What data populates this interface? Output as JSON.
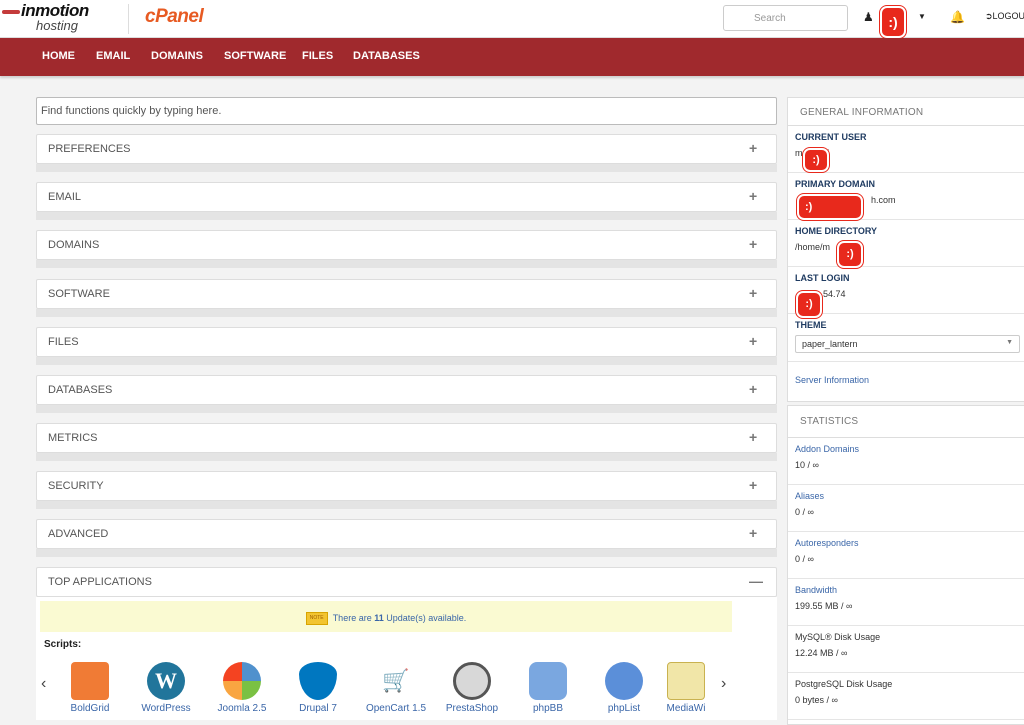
{
  "header": {
    "brand_line1": "inmotion",
    "brand_line2": "hosting",
    "product_logo": "cPanel",
    "search_placeholder": "Search",
    "user_avatar_text": ":)",
    "logout_label": "LOGOU",
    "icons": [
      "user-icon",
      "caret-down-icon",
      "bell-icon",
      "logout-icon"
    ]
  },
  "nav": {
    "items": [
      "HOME",
      "EMAIL",
      "DOMAINS",
      "SOFTWARE",
      "FILES",
      "DATABASES"
    ]
  },
  "main": {
    "find_placeholder": "Find functions quickly by typing here.",
    "groups": [
      {
        "title": "PREFERENCES",
        "toggle": "+"
      },
      {
        "title": "EMAIL",
        "toggle": "+"
      },
      {
        "title": "DOMAINS",
        "toggle": "+"
      },
      {
        "title": "SOFTWARE",
        "toggle": "+"
      },
      {
        "title": "FILES",
        "toggle": "+"
      },
      {
        "title": "DATABASES",
        "toggle": "+"
      },
      {
        "title": "METRICS",
        "toggle": "+"
      },
      {
        "title": "SECURITY",
        "toggle": "+"
      },
      {
        "title": "ADVANCED",
        "toggle": "+"
      },
      {
        "title": "TOP APPLICATIONS",
        "toggle": "—"
      }
    ],
    "update_note_icon_text": "NOTE",
    "update_text_before": "There are",
    "update_count": "11",
    "update_text_after": "Update(s) available.",
    "scripts_label": "Scripts:",
    "prev_arrow": "‹",
    "next_arrow": "›",
    "apps": [
      {
        "name": "BoldGrid",
        "color": "#f07b35"
      },
      {
        "name": "WordPress",
        "color": "#21759b"
      },
      {
        "name": "Joomla 2.5",
        "color": "#5091cd"
      },
      {
        "name": "Drupal 7",
        "color": "#0077c0"
      },
      {
        "name": "OpenCart 1.5",
        "color": "#23a8e0"
      },
      {
        "name": "PrestaShop",
        "color": "#bebebe"
      },
      {
        "name": "phpBB",
        "color": "#7aa7e0"
      },
      {
        "name": "phpList",
        "color": "#5b8fd9"
      },
      {
        "name": "MediaWi",
        "color": "#d8c25a"
      }
    ]
  },
  "sidebar": {
    "general_title": "GENERAL INFORMATION",
    "current_user_label": "CURRENT USER",
    "current_user_value_start": "m",
    "current_user_value_end": "5",
    "primary_domain_label": "PRIMARY DOMAIN",
    "primary_domain_value_end": "h.com",
    "home_directory_label": "HOME DIRECTORY",
    "home_directory_value_start": "/home/m",
    "home_directory_value_end": "5",
    "last_login_label": "LAST LOGIN",
    "last_login_value_end": "54.74",
    "theme_label": "THEME",
    "theme_value": "paper_lantern",
    "server_info_link": "Server Information",
    "statistics_title": "STATISTICS",
    "stats": [
      {
        "label": "Addon Domains",
        "value": "10 / ∞",
        "link": true
      },
      {
        "label": "Aliases",
        "value": "0 / ∞",
        "link": true
      },
      {
        "label": "Autoresponders",
        "value": "0 / ∞",
        "link": true
      },
      {
        "label": "Bandwidth",
        "value": "199.55 MB / ∞",
        "link": true
      },
      {
        "label": "MySQL® Disk Usage",
        "value": "12.24 MB / ∞",
        "link": false
      },
      {
        "label": "PostgreSQL Disk Usage",
        "value": "0 bytes / ∞",
        "link": false
      }
    ],
    "redaction_text": ":)"
  },
  "colors": {
    "nav_bg": "#a0292d",
    "cpanel_orange": "#e75a22",
    "link_blue": "#3a66a8",
    "label_navy": "#1f3b61",
    "redaction_red": "#e8291c"
  }
}
